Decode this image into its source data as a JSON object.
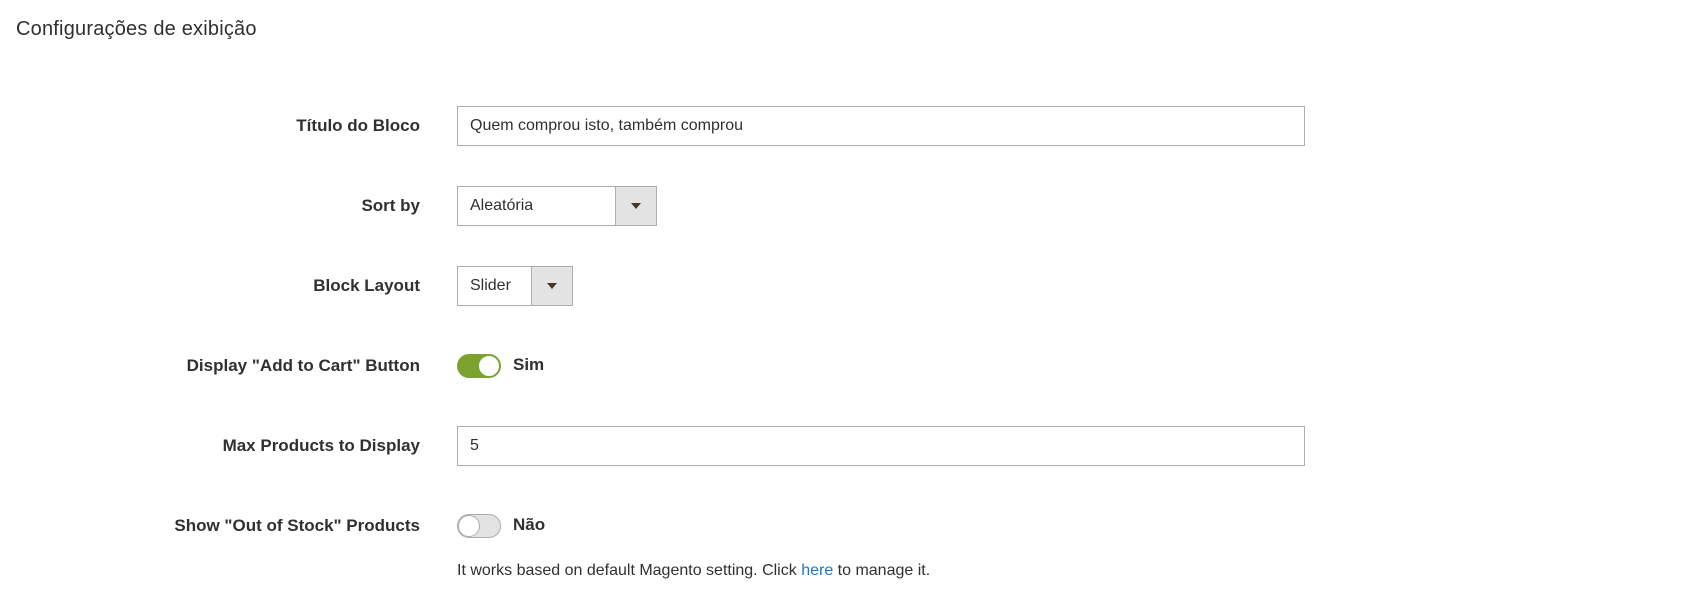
{
  "section": {
    "title": "Configurações de exibição"
  },
  "fields": {
    "block_title": {
      "label": "Título do Bloco",
      "value": "Quem comprou isto, também comprou"
    },
    "sort_by": {
      "label": "Sort by",
      "value": "Aleatória"
    },
    "block_layout": {
      "label": "Block Layout",
      "value": "Slider"
    },
    "add_to_cart": {
      "label": "Display \"Add to Cart\" Button",
      "state_label": "Sim",
      "enabled": true
    },
    "max_products": {
      "label": "Max Products to Display",
      "value": "5"
    },
    "out_of_stock": {
      "label": "Show \"Out of Stock\" Products",
      "state_label": "Não",
      "enabled": false
    }
  },
  "note": {
    "prefix": "It works based on default Magento setting. Click ",
    "link": "here",
    "suffix": " to manage it."
  },
  "colors": {
    "toggle_on": "#79a22e",
    "link": "#1979c3",
    "text": "#303030"
  }
}
